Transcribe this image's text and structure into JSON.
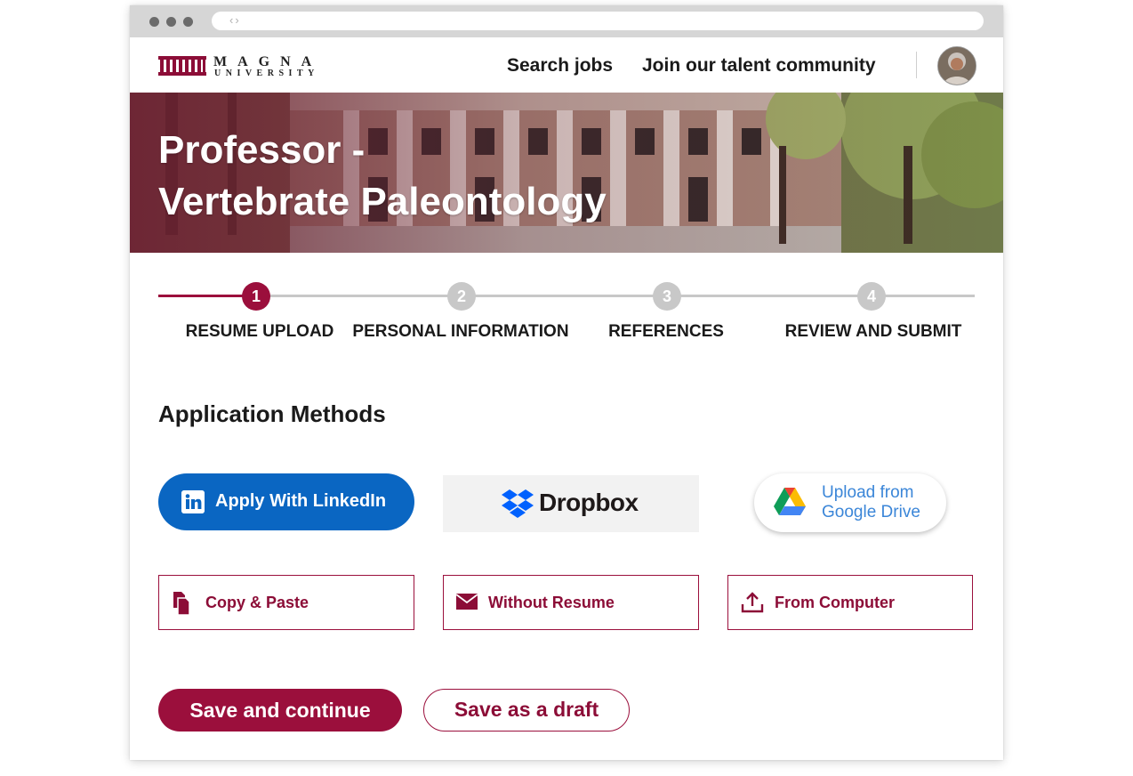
{
  "header": {
    "logo": {
      "wordmark": "MAGNA",
      "subtitle": "UNIVERSITY"
    },
    "nav": [
      "Search jobs",
      "Join our talent community"
    ]
  },
  "hero": {
    "title_line1": "Professor -",
    "title_line2": "Vertebrate Paleontology"
  },
  "stepper": {
    "current_step": 1,
    "steps": [
      {
        "number": "1",
        "label": "RESUME UPLOAD"
      },
      {
        "number": "2",
        "label": "PERSONAL INFORMATION"
      },
      {
        "number": "3",
        "label": "REFERENCES"
      },
      {
        "number": "4",
        "label": "REVIEW AND SUBMIT"
      }
    ]
  },
  "section_title": "Application Methods",
  "methods": {
    "linkedin": "Apply With LinkedIn",
    "dropbox": "Dropbox",
    "gdrive_line1": "Upload from",
    "gdrive_line2": "Google Drive",
    "copy_paste": "Copy & Paste",
    "without_resume": "Without Resume",
    "from_computer": "From Computer"
  },
  "actions": {
    "save_continue": "Save and continue",
    "save_draft": "Save as a draft"
  },
  "colors": {
    "brand": "#9b0f3c",
    "linkedin": "#0a66c2",
    "dropbox": "#0061fe",
    "inactive_step": "#c8c8c8"
  }
}
